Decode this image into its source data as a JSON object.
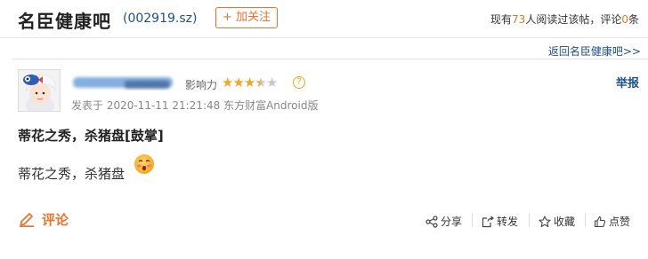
{
  "bar": {
    "title": "名臣健康吧",
    "code": "(002919.sz)",
    "follow_label": "+ 加关注",
    "stats": {
      "prefix": "现有",
      "readers": "73",
      "mid": "人阅读过该帖，评论",
      "comments": "0",
      "suffix": "条"
    },
    "back_link": "返回名臣健康吧>>"
  },
  "post": {
    "author": "",
    "influence_label": "影响力",
    "influence_stars": 3.5,
    "influence_max": 5,
    "help_mark": "?",
    "report_label": "举报",
    "meta": "发表于 2020-11-11 21:21:48 东方财富Android版",
    "title": "蒂花之秀，杀猪盘[鼓掌]",
    "body": "蒂花之秀，杀猪盘"
  },
  "actions": {
    "comment_label": "评论",
    "share_label": "分享",
    "repost_label": "转发",
    "collect_label": "收藏",
    "like_label": "点赞"
  },
  "colors": {
    "accent": "#e8742f",
    "link": "#1f4f8e",
    "star": "#f4a623"
  }
}
